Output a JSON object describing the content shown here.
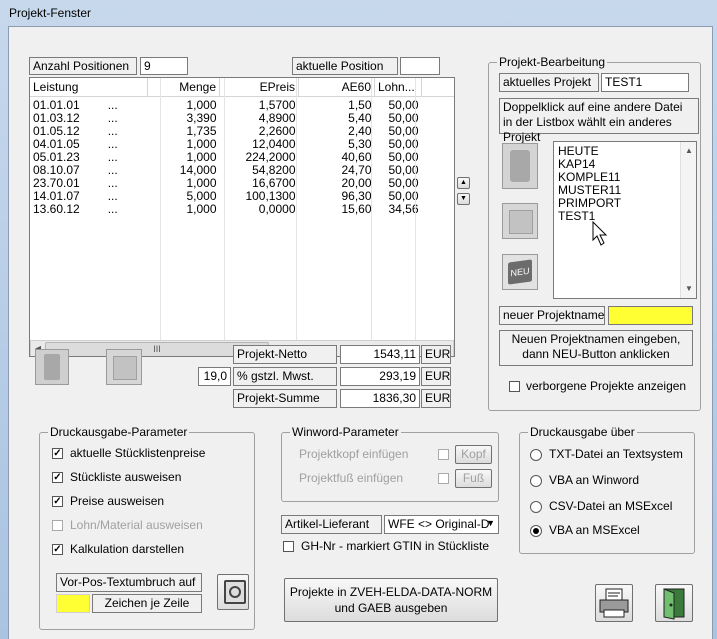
{
  "window": {
    "title": "Projekt-Fenster"
  },
  "positions": {
    "count_label": "Anzahl Positionen",
    "count_value": "9",
    "current_label": "aktuelle Position",
    "current_value": ""
  },
  "table": {
    "headers": [
      "Leistung",
      "Menge",
      "EPreis",
      "AE60",
      "Lohn..."
    ],
    "rows": [
      [
        "01.01.01",
        "...",
        "1,000",
        "1,5700",
        "1,50",
        "50,00"
      ],
      [
        "01.03.12",
        "...",
        "3,390",
        "4,8900",
        "5,40",
        "50,00"
      ],
      [
        "01.05.12",
        "...",
        "1,735",
        "2,2600",
        "2,40",
        "50,00"
      ],
      [
        "04.01.05",
        "...",
        "1,000",
        "12,0400",
        "5,30",
        "50,00"
      ],
      [
        "05.01.23",
        "...",
        "1,000",
        "224,2000",
        "40,60",
        "50,00"
      ],
      [
        "08.10.07",
        "...",
        "14,000",
        "54,8200",
        "24,70",
        "50,00"
      ],
      [
        "23.70.01",
        "...",
        "1,000",
        "16,6700",
        "20,00",
        "50,00"
      ],
      [
        "14.01.07",
        "...",
        "5,000",
        "100,1300",
        "96,30",
        "50,00"
      ],
      [
        "13.60.12",
        "...",
        "1,000",
        "0,0000",
        "15,60",
        "34,56"
      ]
    ],
    "scroll_grip": "III"
  },
  "totals": {
    "netto_label": "Projekt-Netto",
    "netto_value": "1543,11",
    "currency": "EUR",
    "vat_rate": "19,0",
    "vat_label": "% gstzl. Mwst.",
    "vat_value": "293,19",
    "sum_label": "Projekt-Summe",
    "sum_value": "1836,30"
  },
  "project": {
    "group_title": "Projekt-Bearbeitung",
    "current_label": "aktuelles Projekt",
    "current_value": "TEST1",
    "hint": "Doppelklick auf eine andere Datei in der Listbox wählt ein anderes Projekt",
    "projects": [
      "HEUTE",
      "KAP14",
      "KOMPLE11",
      "MUSTER11",
      "PRIMPORT",
      "TEST1"
    ],
    "new_name_label": "neuer Projektname",
    "new_name_value": "",
    "new_hint_line1": "Neuen Projektnamen eingeben,",
    "new_hint_line2": "dann NEU-Button anklicken",
    "hidden_label": "verborgene Projekte anzeigen",
    "new_icon_text": "NEU"
  },
  "print_params": {
    "group_title": "Druckausgabe-Parameter",
    "items": [
      {
        "label": "aktuelle Stücklistenpreise",
        "checked": true,
        "enabled": true
      },
      {
        "label": "Stückliste ausweisen",
        "checked": true,
        "enabled": true
      },
      {
        "label": "Preise ausweisen",
        "checked": true,
        "enabled": true
      },
      {
        "label": "Lohn/Material ausweisen",
        "checked": false,
        "enabled": false
      },
      {
        "label": "Kalkulation darstellen",
        "checked": true,
        "enabled": true
      }
    ],
    "wrap_label": "Vor-Pos-Textumbruch auf",
    "wrap_value": "",
    "wrap_unit": "Zeichen je Zeile"
  },
  "winword": {
    "group_title": "Winword-Parameter",
    "head_label": "Projektkopf einfügen",
    "head_button": "Kopf",
    "foot_label": "Projektfuß einfügen",
    "foot_button": "Fuß"
  },
  "supplier": {
    "label": "Artikel-Lieferant",
    "value": "WFE <> Original-D",
    "gh_label": "GH-Nr - markiert GTIN in Stückliste"
  },
  "print_via": {
    "group_title": "Druckausgabe über",
    "options": [
      "TXT-Datei an Textsystem",
      "VBA an Winword",
      "CSV-Datei an MSExcel",
      "VBA an MSExcel"
    ],
    "selected_index": 3
  },
  "export": {
    "line1": "Projekte in ZVEH-ELDA-DATA-NORM",
    "line2": "und GAEB ausgeben"
  },
  "colors": {
    "highlight_yellow": "#ffff33",
    "titlebar": "#b7cde6"
  }
}
